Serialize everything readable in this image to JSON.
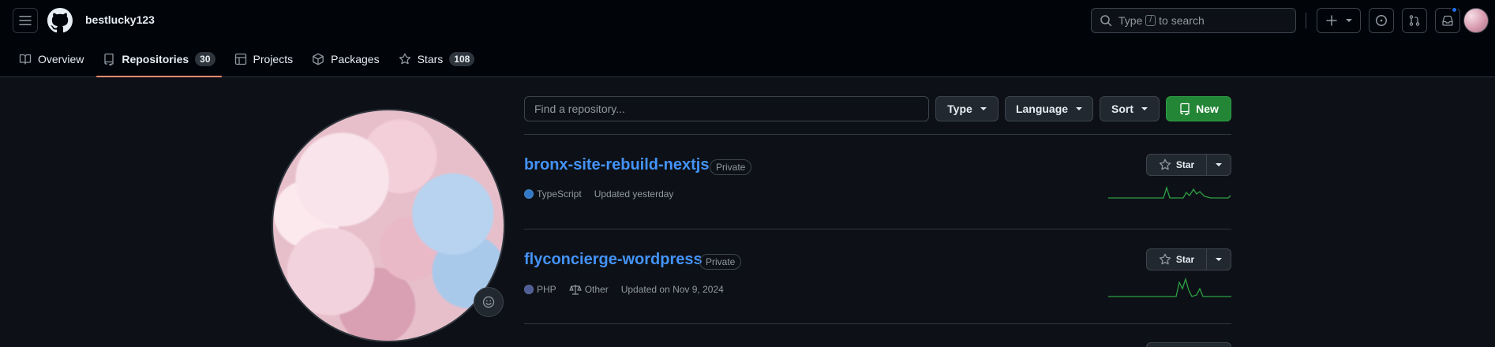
{
  "header": {
    "username": "bestlucky123",
    "search_placeholder_pre": "Type",
    "search_key": "/",
    "search_placeholder_post": "to search"
  },
  "tabs": [
    {
      "label": "Overview",
      "icon": "book-icon"
    },
    {
      "label": "Repositories",
      "icon": "repo-icon",
      "count": "30",
      "active": true
    },
    {
      "label": "Projects",
      "icon": "table-icon"
    },
    {
      "label": "Packages",
      "icon": "package-icon"
    },
    {
      "label": "Stars",
      "icon": "star-icon",
      "count": "108"
    }
  ],
  "filters": {
    "find_placeholder": "Find a repository...",
    "type_label": "Type",
    "language_label": "Language",
    "sort_label": "Sort",
    "new_label": "New"
  },
  "repos": [
    {
      "name": "bronx-site-rebuild-nextjs",
      "visibility": "Private",
      "language": "TypeScript",
      "language_color": "#3178c6",
      "updated": "Updated yesterday",
      "star_label": "Star"
    },
    {
      "name": "flyconcierge-wordpress",
      "visibility": "Private",
      "language": "PHP",
      "language_color": "#4F5D95",
      "license": "Other",
      "updated": "Updated on Nov 9, 2024",
      "star_label": "Star"
    }
  ],
  "colors": {
    "accent": "#4493f8",
    "new_button": "#238636",
    "tab_underline": "#fd8c73",
    "sparkline": "#2ea043"
  }
}
